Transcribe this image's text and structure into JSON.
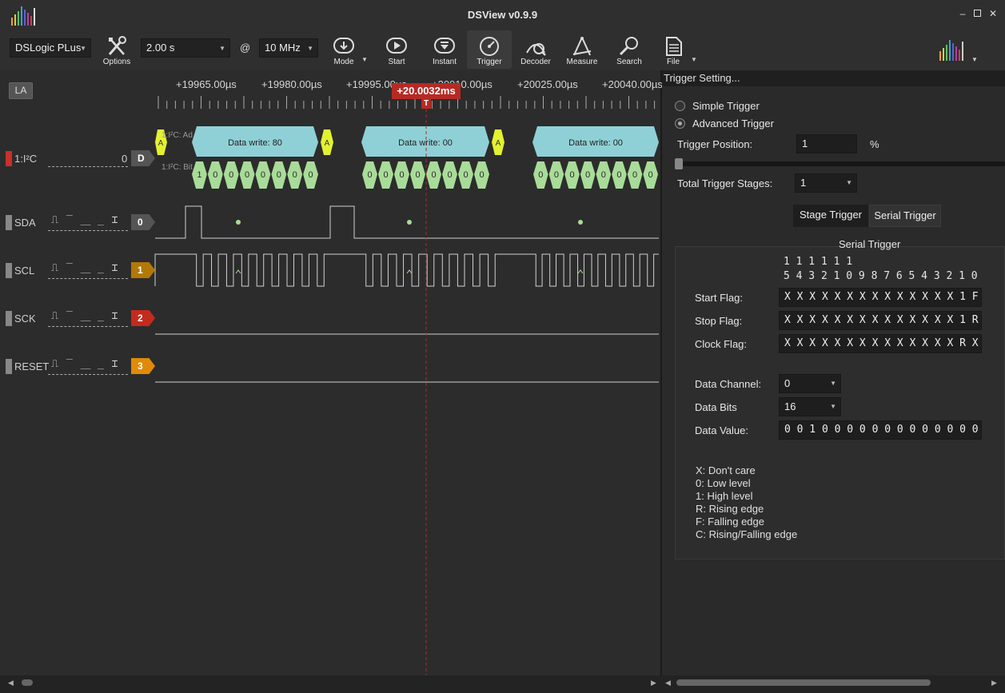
{
  "window": {
    "title": "DSView v0.9.9"
  },
  "colors": {
    "accent_red": "#c8302a",
    "i2c_cyan": "#8fd0d6",
    "bit_green": "#a8dc98",
    "ack_yellow": "#e3f230",
    "ch1_orange": "#b37806",
    "ch2_red": "#c42a1d",
    "ch3_orange": "#e08a08"
  },
  "toolbar": {
    "device": "DSLogic PLus",
    "options_label": "Options",
    "duration": "2.00 s",
    "at": "@",
    "rate": "10 MHz",
    "mode_label": "Mode",
    "start_label": "Start",
    "instant_label": "Instant",
    "trigger_label": "Trigger",
    "decoder_label": "Decoder",
    "measure_label": "Measure",
    "search_label": "Search",
    "file_label": "File"
  },
  "ruler": {
    "la_label": "LA",
    "ticks": [
      "+19965.00µs",
      "+19980.00µs",
      "+19995.00µs",
      "+20010.00µs",
      "+20025.00µs",
      "+20040.00µs"
    ],
    "cursor_time": "+20.0032ms",
    "cursor_marker": "T"
  },
  "channels": [
    {
      "label": "1:I²C",
      "badge": "D",
      "count": "0"
    },
    {
      "label": "SDA",
      "badge": "0"
    },
    {
      "label": "SCL",
      "badge": "1"
    },
    {
      "label": "SCK",
      "badge": "2"
    },
    {
      "label": "RESET",
      "badge": "3"
    }
  ],
  "decoder": {
    "row1_prefix": "1:I²C: Ad",
    "row2_prefix": "1:I²C: Bit",
    "ack": "A",
    "frames": [
      "Data write: 80",
      "Data write: 00",
      "Data write: 00"
    ],
    "bits": [
      [
        "1",
        "0",
        "0",
        "0",
        "0",
        "0",
        "0",
        "0"
      ],
      [
        "0",
        "0",
        "0",
        "0",
        "0",
        "0",
        "0",
        "0"
      ],
      [
        "0",
        "0",
        "0",
        "0",
        "0",
        "0",
        "0",
        "0"
      ]
    ]
  },
  "trigger_panel": {
    "header": "Trigger Setting...",
    "simple": "Simple Trigger",
    "advanced": "Advanced Trigger",
    "position_label": "Trigger Position:",
    "position_value": "1",
    "position_unit": "%",
    "position_fraction": 0.0,
    "stages_label": "Total Trigger Stages:",
    "stages_value": "1",
    "tab_stage": "Stage Trigger",
    "tab_serial": "Serial Trigger",
    "group_title": "Serial Trigger",
    "bit_header_top": "1 1 1 1 1 1",
    "bit_header_bottom": "5 4 3 2 1 0 9 8 7 6 5 4 3 2 1 0",
    "start_flag_label": "Start Flag:",
    "start_flag_value": "X X X X X X X X X X X X X X 1 F",
    "stop_flag_label": "Stop Flag:",
    "stop_flag_value": "X X X X X X X X X X X X X X 1 R",
    "clock_flag_label": "Clock Flag:",
    "clock_flag_value": "X X X X X X X X X X X X X X R X",
    "data_channel_label": "Data Channel:",
    "data_channel_value": "0",
    "data_bits_label": "Data Bits",
    "data_bits_value": "16",
    "data_value_label": "Data Value:",
    "data_value_value": "0 0 1 0 0 0 0 0 0 0 0 0 0 0 0 0",
    "legend": [
      "X: Don't care",
      "0: Low level",
      "1: High level",
      "R: Rising edge",
      "F: Falling edge",
      "C: Rising/Falling edge"
    ]
  }
}
